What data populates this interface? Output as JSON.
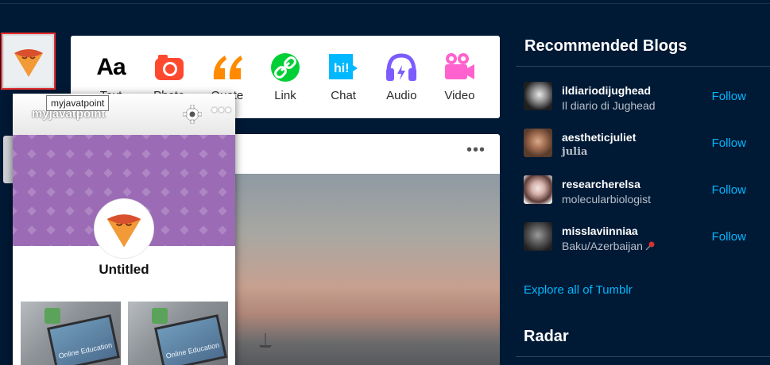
{
  "tooltip": "myjavatpoint",
  "compose": {
    "items": [
      {
        "label": "Text",
        "icon": "text-aa-icon"
      },
      {
        "label": "Photo",
        "icon": "camera-icon",
        "color": "#ff492f"
      },
      {
        "label": "Quote",
        "icon": "quote-icon",
        "color": "#ff8a00"
      },
      {
        "label": "Link",
        "icon": "link-icon",
        "color": "#00cf35"
      },
      {
        "label": "Chat",
        "icon": "chat-icon",
        "color": "#00b8ff"
      },
      {
        "label": "Audio",
        "icon": "headphones-icon",
        "color": "#7c5cff"
      },
      {
        "label": "Video",
        "icon": "video-camera-icon",
        "color": "#ff62ce"
      }
    ],
    "text_icon_label": "Aa"
  },
  "popup": {
    "blog_name": "myjavatpoint",
    "title": "Untitled",
    "thumb_caption": "Online Education"
  },
  "post": {
    "more_label": "•••"
  },
  "sidebar": {
    "recommended_title": "Recommended Blogs",
    "blogs": [
      {
        "name": "ildiariodijughead",
        "subtitle": "Il diario di Jughead",
        "follow": "Follow"
      },
      {
        "name": "aestheticjuliet",
        "subtitle": "julia",
        "follow": "Follow"
      },
      {
        "name": "researcherelsa",
        "subtitle": "molecularbiologist",
        "follow": "Follow"
      },
      {
        "name": "misslaviinniaa",
        "subtitle": "Baku/Azerbaijan",
        "follow": "Follow"
      }
    ],
    "explore_label": "Explore all of Tumblr",
    "radar_title": "Radar"
  },
  "colors": {
    "background": "#001935",
    "accent_link": "#00b8ff",
    "avatar_highlight": "#e52d2d"
  }
}
